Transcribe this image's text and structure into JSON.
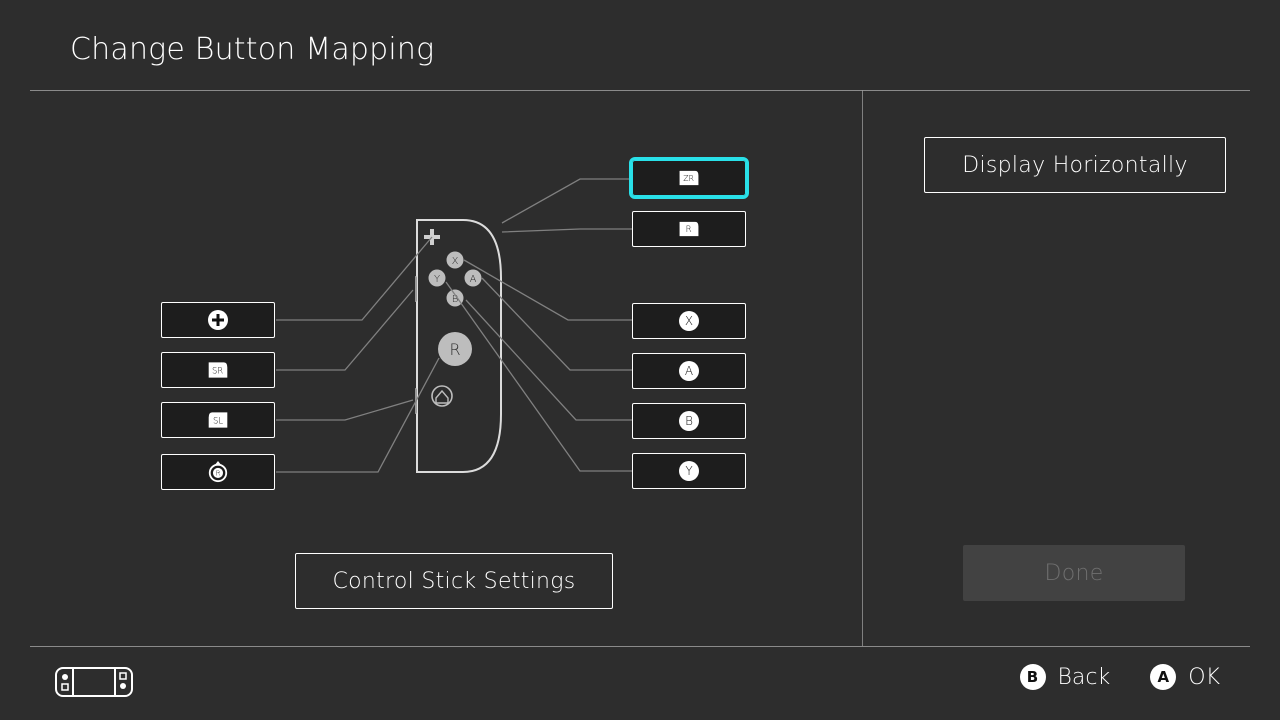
{
  "screen": {
    "title": "Change Button Mapping"
  },
  "actions": {
    "display_horizontally": "Display Horizontally",
    "control_stick_settings": "Control Stick Settings",
    "done": "Done"
  },
  "footer": {
    "b_label": "Back",
    "a_label": "OK"
  },
  "controller": {
    "side": "R",
    "stick_label": "R"
  },
  "mappings": {
    "left": [
      {
        "id": "plus",
        "kind": "plus"
      },
      {
        "id": "sr",
        "kind": "cap",
        "text": "SR"
      },
      {
        "id": "sl",
        "kind": "cap",
        "text": "SL"
      },
      {
        "id": "stick-r",
        "kind": "stickpress",
        "text": "R"
      }
    ],
    "right": [
      {
        "id": "zr",
        "kind": "cap",
        "text": "ZR",
        "selected": true
      },
      {
        "id": "r",
        "kind": "cap",
        "text": "R"
      },
      {
        "id": "x",
        "kind": "round",
        "text": "X"
      },
      {
        "id": "a",
        "kind": "round",
        "text": "A"
      },
      {
        "id": "b",
        "kind": "round",
        "text": "B"
      },
      {
        "id": "y",
        "kind": "round",
        "text": "Y"
      }
    ]
  }
}
